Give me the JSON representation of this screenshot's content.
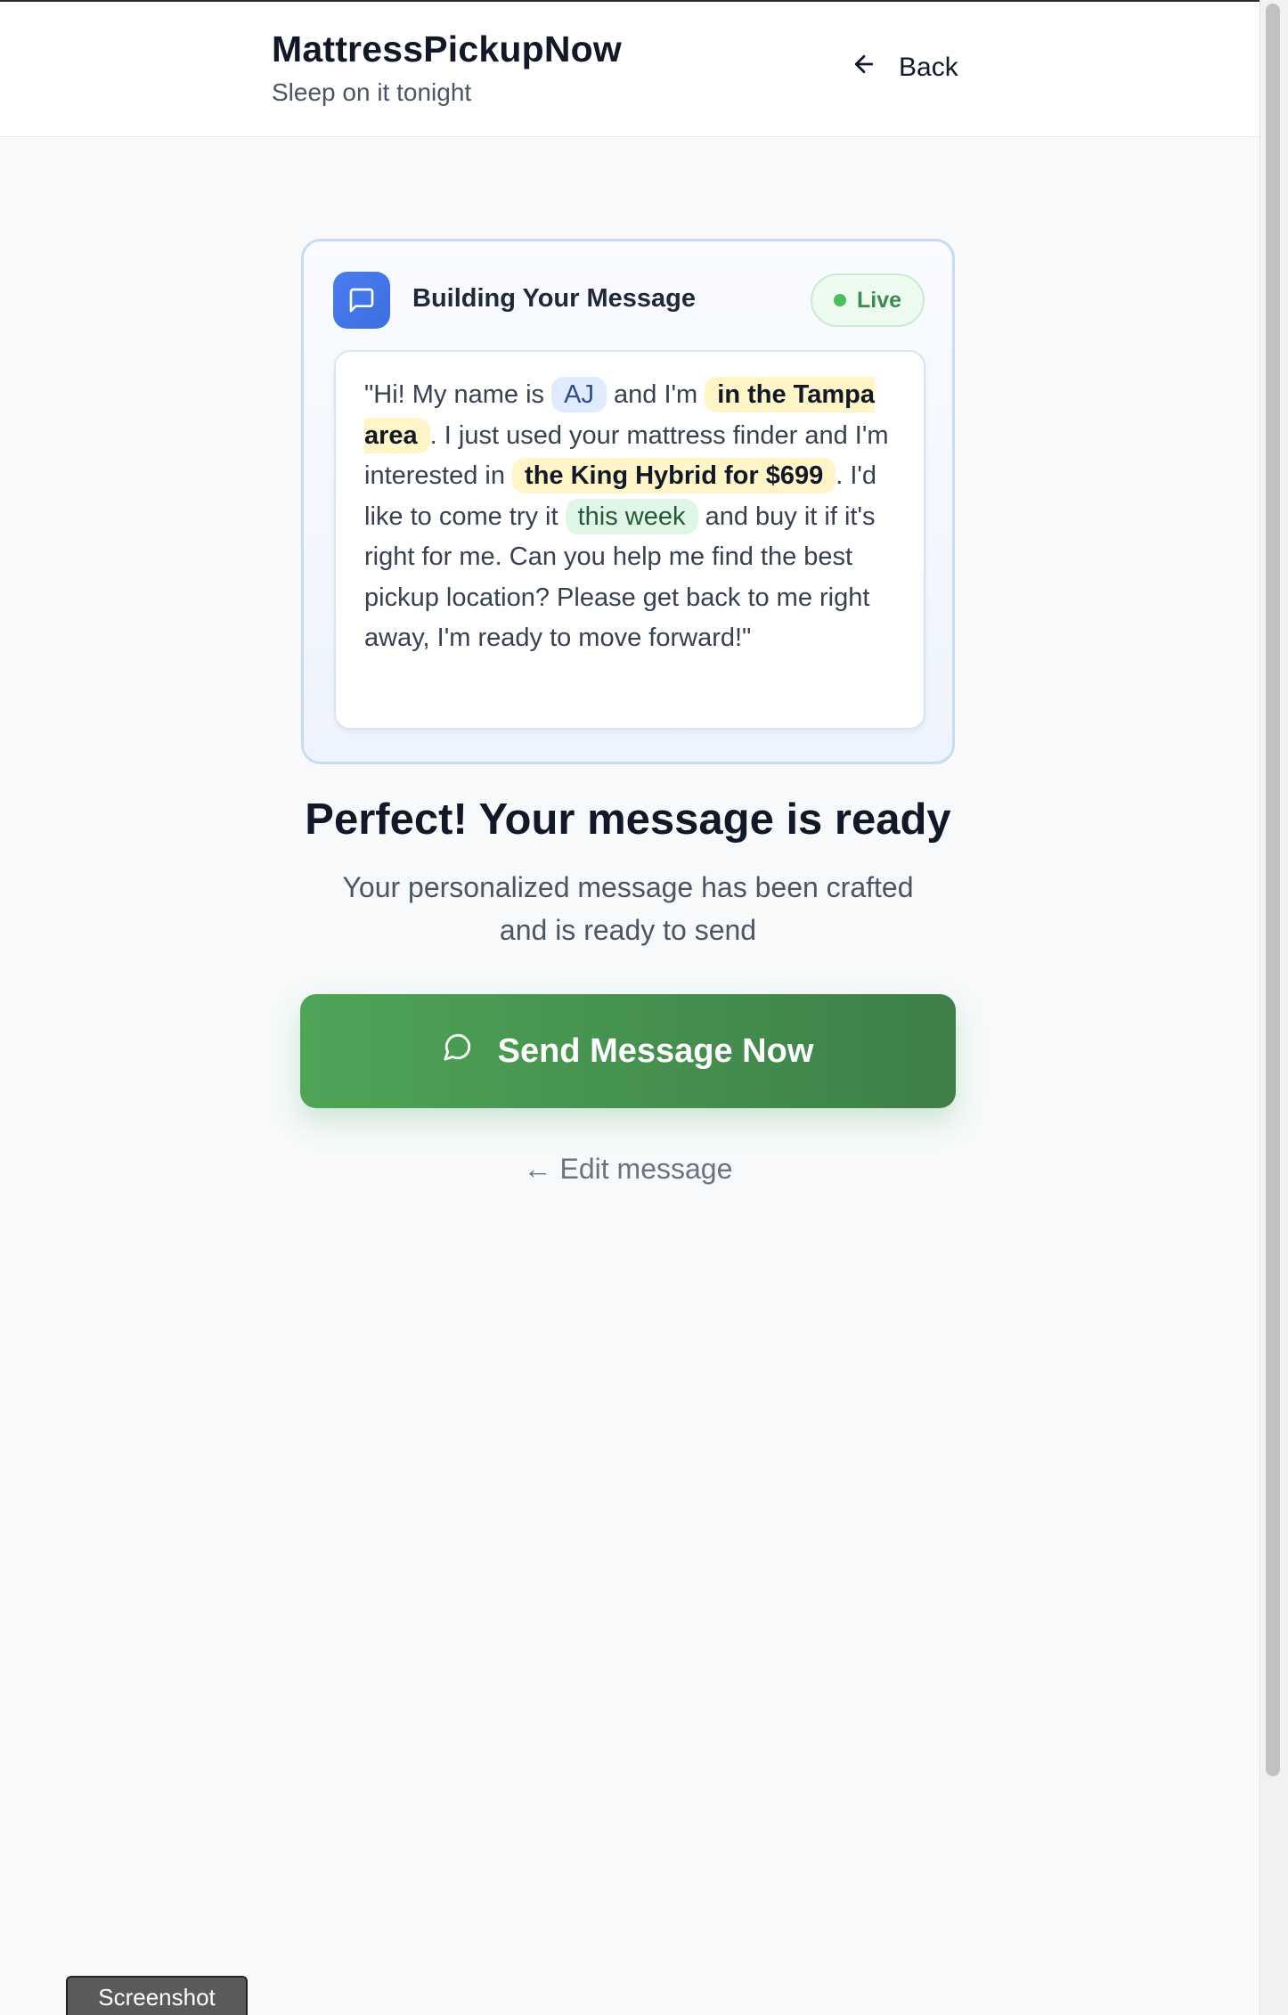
{
  "header": {
    "brand_title": "MattressPickupNow",
    "brand_subtitle": "Sleep on it tonight",
    "back_label": "Back"
  },
  "card": {
    "title": "Building Your Message",
    "live_label": "Live",
    "message": {
      "part1": "\"Hi! My name is ",
      "name": "AJ",
      "part2": " and I'm ",
      "location": "in the Tampa area",
      "part3": ". I just used your mattress finder and I'm interested in ",
      "product": "the King Hybrid for $699",
      "part4": ". I'd like to come try it ",
      "timing": "this week",
      "part5": " and buy it if it's right for me. Can you help me find the best pickup location? Please get back to me right away, I'm ready to move forward!\""
    }
  },
  "main": {
    "headline": "Perfect! Your message is ready",
    "subline": "Your personalized message has been crafted and is ready to send",
    "send_button": "Send Message Now",
    "edit_link": "← Edit message"
  },
  "footer": {
    "screenshot_label": "Screenshot"
  },
  "colors": {
    "accent_blue": "#3b6ee0",
    "send_green": "#4ea556",
    "live_green": "#4cbb62",
    "highlight_yellow": "#fff5c7"
  }
}
